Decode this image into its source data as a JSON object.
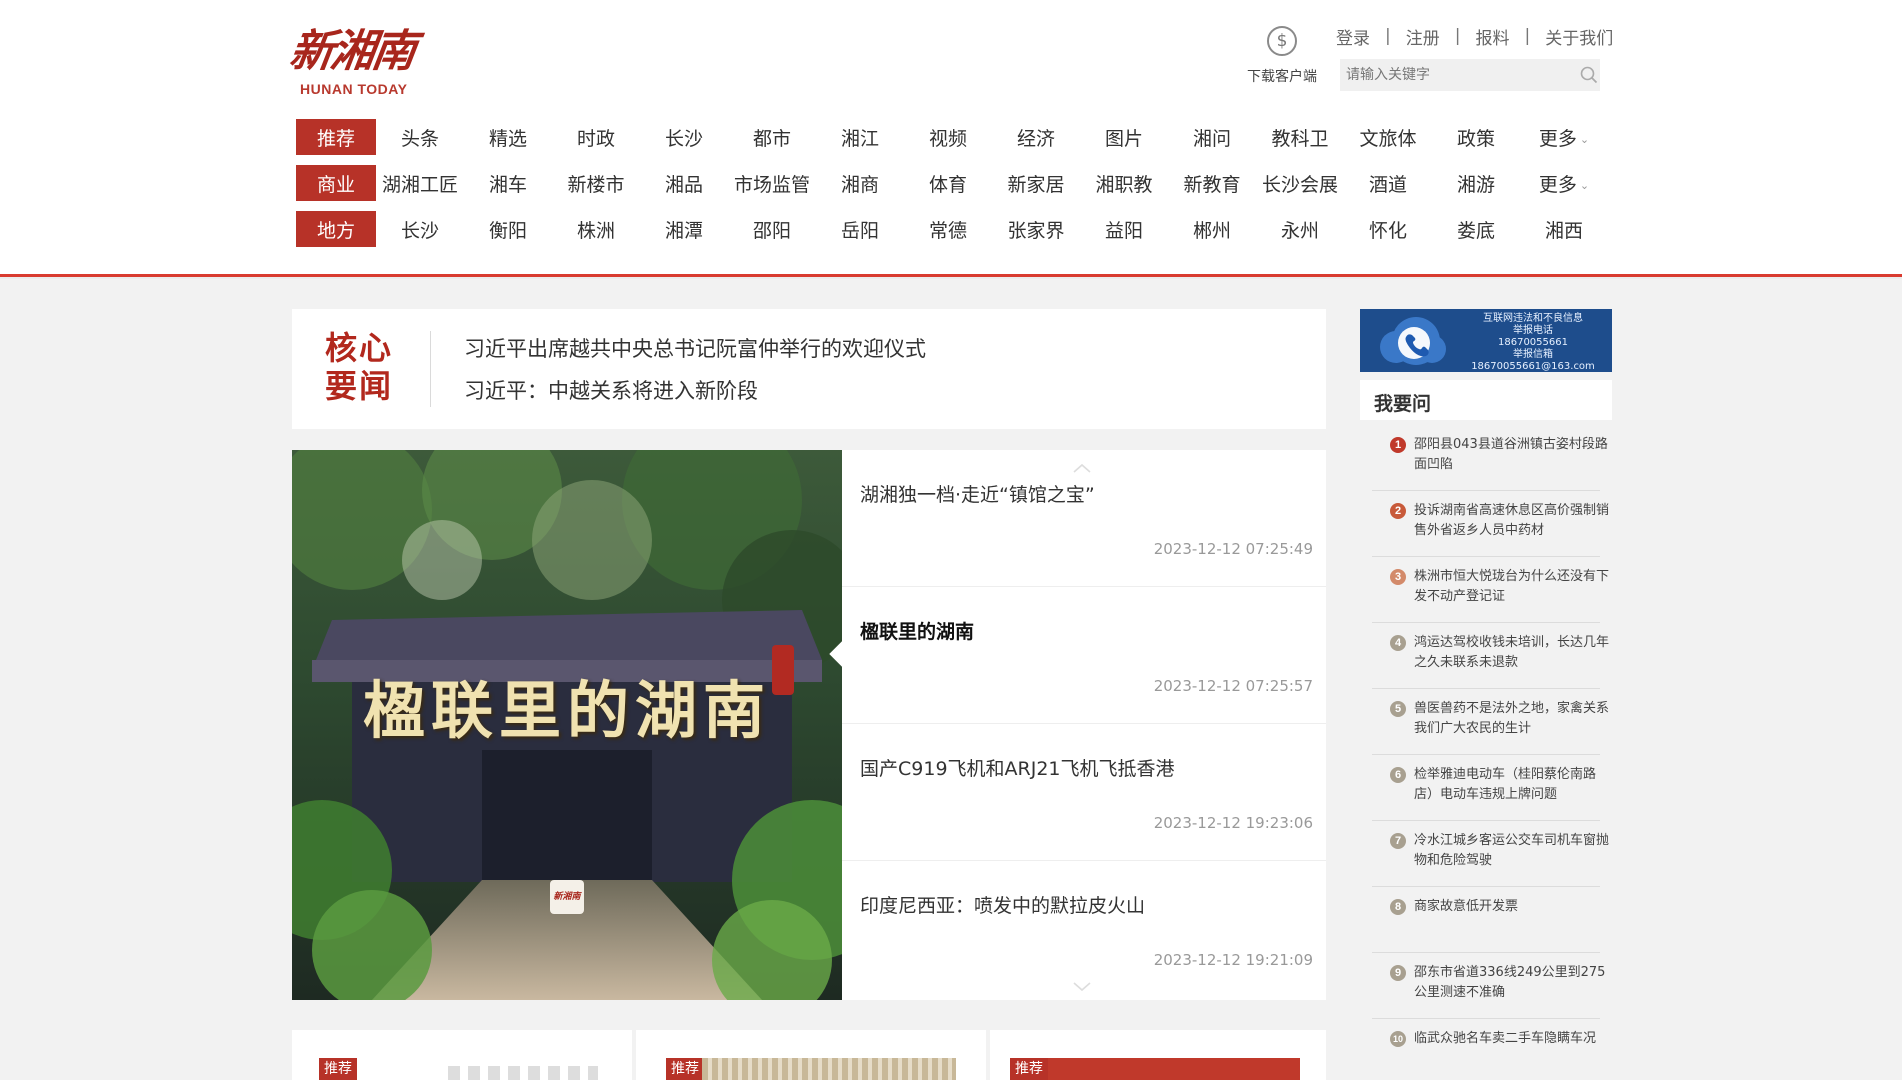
{
  "logo": {
    "main": "新湘南",
    "sub": "HUNAN TODAY"
  },
  "download": {
    "label": "下载客户端",
    "icon": "download-icon"
  },
  "top_links": [
    "登录",
    "注册",
    "报料",
    "关于我们"
  ],
  "top_links_separator": "|",
  "search": {
    "placeholder": "请输入关键字",
    "icon": "search-icon"
  },
  "nav": [
    {
      "label": "推荐",
      "items": [
        "头条",
        "精选",
        "时政",
        "长沙",
        "都市",
        "湘江",
        "视频",
        "经济",
        "图片",
        "湘问",
        "教科卫",
        "文旅体",
        "政策"
      ],
      "more": "更多"
    },
    {
      "label": "商业",
      "items": [
        "湖湘工匠",
        "湘车",
        "新楼市",
        "湘品",
        "市场监管",
        "湘商",
        "体育",
        "新家居",
        "湘职教",
        "新教育",
        "长沙会展",
        "酒道",
        "湘游"
      ],
      "more": "更多"
    },
    {
      "label": "地方",
      "items": [
        "长沙",
        "衡阳",
        "株洲",
        "湘潭",
        "邵阳",
        "岳阳",
        "常德",
        "张家界",
        "益阳",
        "郴州",
        "永州",
        "怀化",
        "娄底",
        "湘西"
      ],
      "more": ""
    }
  ],
  "core_news": {
    "tag_line1": "核心",
    "tag_line2": "要闻",
    "headlines": [
      "习近平出席越共中央总书记阮富仲举行的欢迎仪式",
      "习近平：中越关系将进入新阶段"
    ]
  },
  "feature": {
    "image_caption": "楹联里的湖南",
    "image_watermark": "新湘南",
    "stories": [
      {
        "title": "湖湘独一档·走近“镇馆之宝”",
        "time": "2023-12-12 07:25:49"
      },
      {
        "title": "楹联里的湖南",
        "time": "2023-12-12 07:25:57"
      },
      {
        "title": "国产C919飞机和ARJ21飞机飞抵香港",
        "time": "2023-12-12 19:23:06"
      },
      {
        "title": "印度尼西亚：喷发中的默拉皮火山",
        "time": "2023-12-12 19:21:09"
      }
    ]
  },
  "bottom_cards": [
    {
      "badge": "推荐"
    },
    {
      "badge": "推荐"
    },
    {
      "badge": "推荐"
    }
  ],
  "sidebar": {
    "banner": {
      "line1": "互联网违法和不良信息",
      "line2": "举报电话",
      "line3": "18670055661",
      "line4": "举报信箱",
      "line5": "18670055661@163.com"
    },
    "ask_title": "我要问",
    "ask_items": [
      {
        "num": "1",
        "text": "邵阳县043县道谷洲镇古姿村段路面凹陷"
      },
      {
        "num": "2",
        "text": "投诉湖南省高速休息区高价强制销售外省返乡人员中药材"
      },
      {
        "num": "3",
        "text": "株洲市恒大悦珑台为什么还没有下发不动产登记证"
      },
      {
        "num": "4",
        "text": "鸿运达驾校收钱未培训，长达几年之久未联系未退款"
      },
      {
        "num": "5",
        "text": "兽医兽药不是法外之地，家禽关系我们广大农民的生计"
      },
      {
        "num": "6",
        "text": "检举雅迪电动车（桂阳蔡伦南路店）电动车违规上牌问题"
      },
      {
        "num": "7",
        "text": "冷水江城乡客运公交车司机车窗抛物和危险驾驶"
      },
      {
        "num": "8",
        "text": "商家故意低开发票"
      },
      {
        "num": "9",
        "text": "邵东市省道336线249公里到275公里测速不准确"
      },
      {
        "num": "10",
        "text": "临武众驰名车卖二手车隐瞒车况"
      }
    ]
  },
  "colors": {
    "brand_red": "#b73228",
    "header_line": "#d93b30",
    "banner_blue": "#1e4d8c"
  }
}
